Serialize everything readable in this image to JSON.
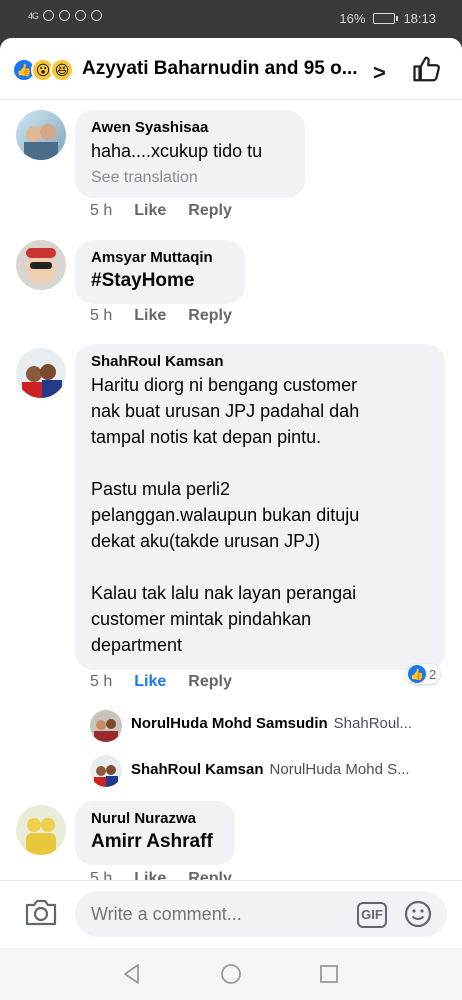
{
  "status_bar": {
    "signal": "4G",
    "battery": "16%",
    "time": "18:13"
  },
  "header": {
    "reactions_label": "Azyyati Baharnudin and 95 o...",
    "reaction_icons": [
      "like-icon",
      "wow-icon",
      "haha-icon"
    ]
  },
  "comments": [
    {
      "author": "Awen Syashisaa",
      "text": "haha....xcukup tido tu",
      "see_translation": "See translation",
      "time": "5 h",
      "like": "Like",
      "reply": "Reply"
    },
    {
      "author": "Amsyar Muttaqin",
      "text": "#StayHome",
      "time": "5 h",
      "like": "Like",
      "reply": "Reply"
    },
    {
      "author": "ShahRoul Kamsan",
      "text": "Haritu diorg ni bengang customer\nnak buat urusan JPJ padahal dah\ntampal notis kat depan pintu.\n\nPastu mula perli2\npelanggan.walaupun bukan dituju\ndekat aku(takde urusan JPJ)\n\nKalau tak lalu nak layan perangai\ncustomer mintak pindahkan\ndepartment",
      "time": "5 h",
      "like": "Like",
      "reply": "Reply",
      "reaction_count": "2",
      "replies": [
        {
          "author": "NorulHuda Mohd Samsudin",
          "preview": "ShahRoul..."
        },
        {
          "author": "ShahRoul Kamsan",
          "preview": "NorulHuda Mohd S..."
        }
      ]
    },
    {
      "author": "Nurul Nurazwa",
      "text": "Amirr Ashraff",
      "time": "5 h",
      "like": "Like",
      "reply": "Reply"
    }
  ],
  "composer": {
    "placeholder": "Write a comment...",
    "gif_label": "GIF"
  },
  "colors": {
    "accent": "#1877f2",
    "bubble": "#f0f2f5",
    "muted": "#65676b"
  }
}
